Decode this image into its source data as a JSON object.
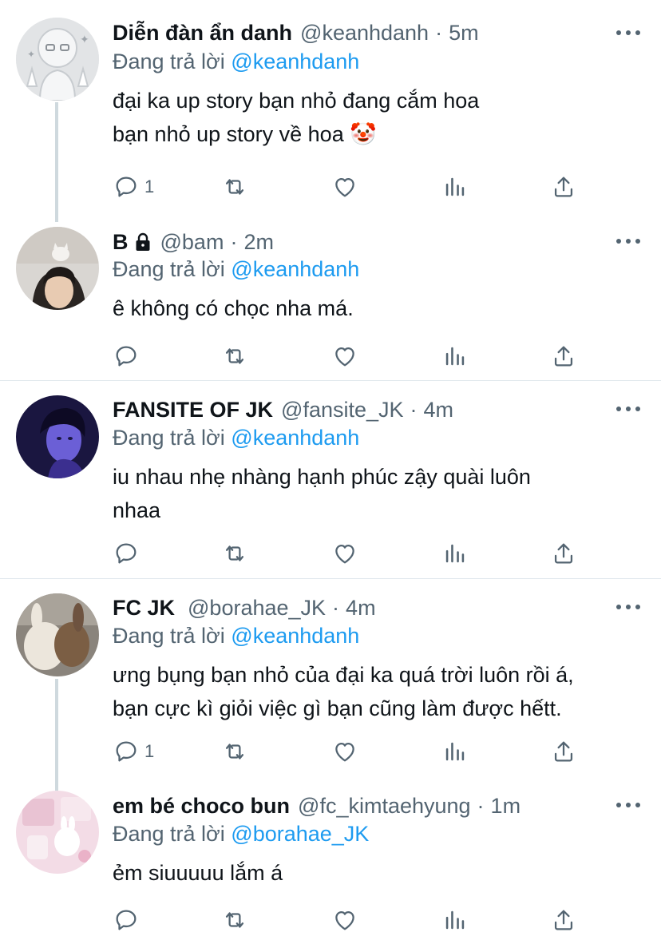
{
  "tweets": [
    {
      "name": "Diễn đàn ẩn danh",
      "handle": "@keanhdanh",
      "time": "5m",
      "reply_prefix": "Đang trả lời",
      "reply_to": "@keanhdanh",
      "lines": [
        "đại ka up story bạn nhỏ đang cắm hoa",
        "bạn nhỏ up story về hoa 🤡"
      ],
      "reply_count": "1",
      "avatar": "anonymous-mask-avatar"
    },
    {
      "name": "B",
      "handle": "@bam",
      "time": "2m",
      "reply_prefix": "Đang trả lời",
      "reply_to": "@keanhdanh",
      "lines": [
        "ê không có chọc nha má."
      ],
      "reply_count": "",
      "avatar": "photo-cat-person",
      "locked": true
    },
    {
      "name": "FANSITE OF JK",
      "handle": "@fansite_JK",
      "time": "4m",
      "reply_prefix": "Đang trả lời",
      "reply_to": "@keanhdanh",
      "lines": [
        "iu nhau nhẹ nhàng hạnh phúc zậy quài luôn",
        "nhaa"
      ],
      "reply_count": "",
      "avatar": "photo-purple-portrait"
    },
    {
      "name": "FC JK",
      "handle": "@borahae_JK",
      "time": "4m",
      "reply_prefix": "Đang trả lời",
      "reply_to": "@keanhdanh",
      "lines": [
        "ưng bụng bạn nhỏ của đại ka quá trời luôn rồi á,",
        "bạn cực kì giỏi việc gì bạn cũng làm được hếtt."
      ],
      "reply_count": "1",
      "avatar": "photo-plush-bunnies"
    },
    {
      "name": "em bé choco bun",
      "handle": "@fc_kimtaehyung",
      "time": "1m",
      "reply_prefix": "Đang trả lời",
      "reply_to": "@borahae_JK",
      "lines": [
        "ẻm siuuuuu lắm á"
      ],
      "reply_count": "",
      "avatar": "photo-pink-collage"
    }
  ],
  "colors": {
    "link": "#1d9bf0",
    "secondary": "#536471",
    "text": "#0f1419",
    "divider": "#e1e8ed",
    "thread": "#cfd9de"
  },
  "icons": [
    "reply-icon",
    "retweet-icon",
    "like-icon",
    "analytics-icon",
    "share-icon",
    "more-icon",
    "lock-icon"
  ]
}
